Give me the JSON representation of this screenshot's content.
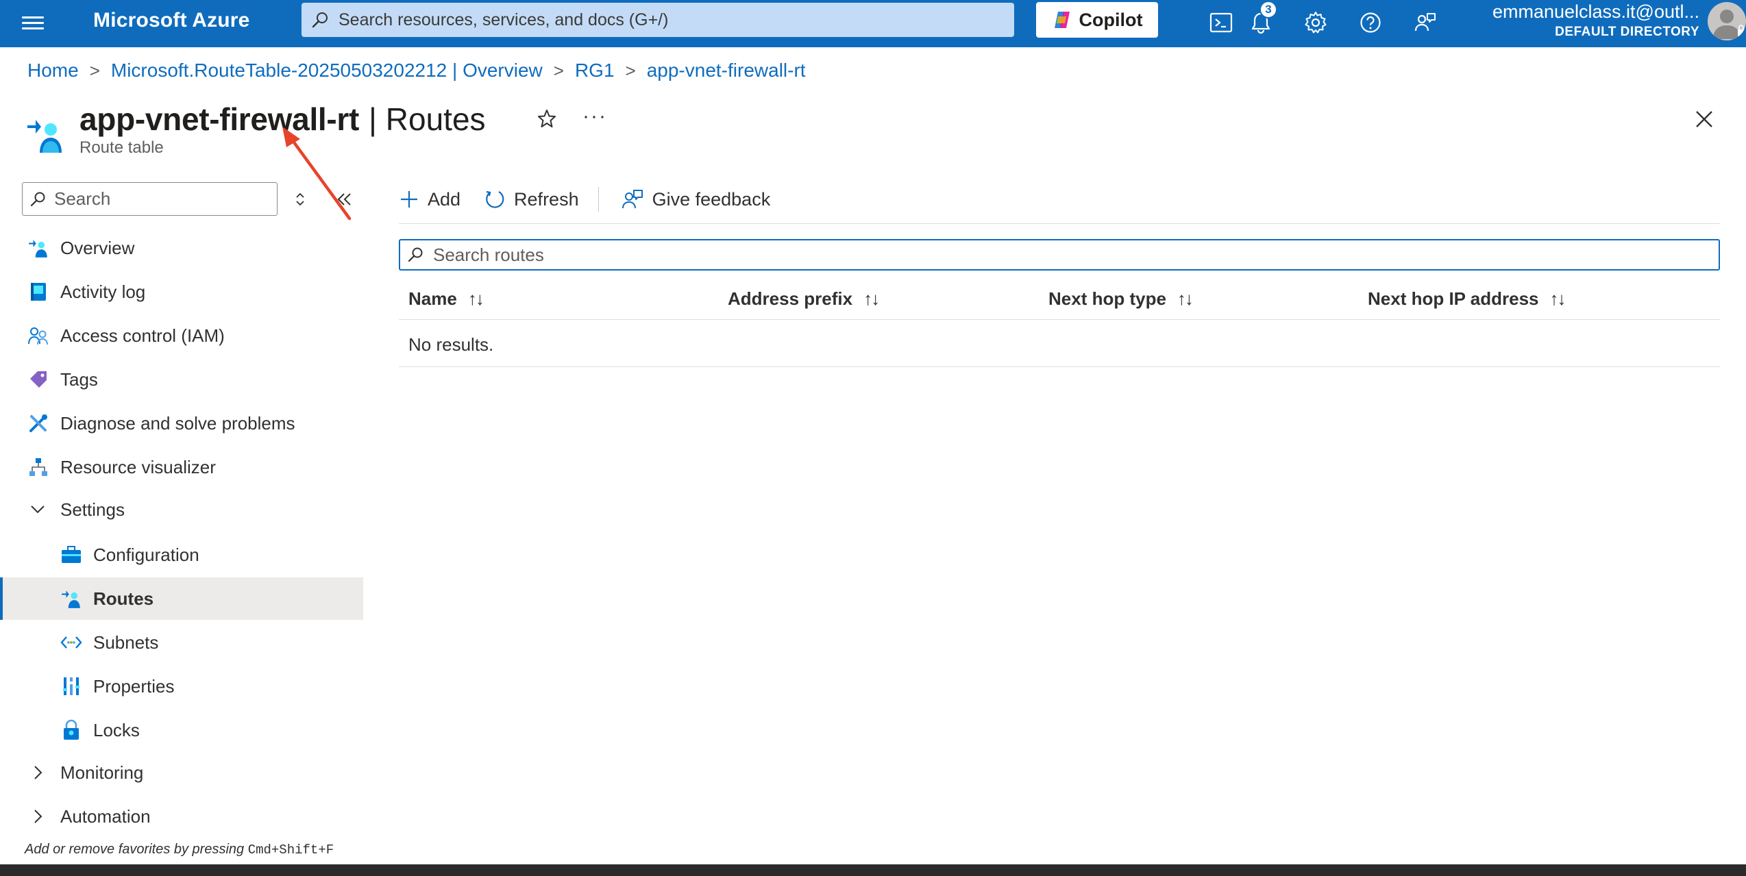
{
  "topbar": {
    "brand": "Microsoft Azure",
    "search_placeholder": "Search resources, services, and docs (G+/)",
    "copilot_label": "Copilot",
    "notification_count": "3",
    "account_email": "emmanuelclass.it@outl...",
    "account_directory": "DEFAULT DIRECTORY",
    "icons": [
      "hamburger-icon",
      "search-icon",
      "copilot-icon",
      "cloud-shell-icon",
      "bell-icon",
      "gear-icon",
      "help-icon",
      "feedback-icon",
      "avatar"
    ]
  },
  "breadcrumb": {
    "items": [
      "Home",
      "Microsoft.RouteTable-20250503202212 | Overview",
      "RG1",
      "app-vnet-firewall-rt"
    ]
  },
  "header": {
    "resource_name": "app-vnet-firewall-rt",
    "page_suffix": "| Routes",
    "resource_type": "Route table"
  },
  "sidebar": {
    "search_placeholder": "Search",
    "items": [
      {
        "label": "Overview",
        "icon": "route-table-icon"
      },
      {
        "label": "Activity log",
        "icon": "activity-log-icon"
      },
      {
        "label": "Access control (IAM)",
        "icon": "iam-icon"
      },
      {
        "label": "Tags",
        "icon": "tag-icon"
      },
      {
        "label": "Diagnose and solve problems",
        "icon": "wrench-icon"
      },
      {
        "label": "Resource visualizer",
        "icon": "visualizer-icon"
      },
      {
        "label": "Settings",
        "icon": "chevron-down-icon"
      },
      {
        "label": "Configuration",
        "icon": "configuration-icon"
      },
      {
        "label": "Routes",
        "icon": "route-table-icon"
      },
      {
        "label": "Subnets",
        "icon": "subnet-icon"
      },
      {
        "label": "Properties",
        "icon": "properties-icon"
      },
      {
        "label": "Locks",
        "icon": "lock-icon"
      },
      {
        "label": "Monitoring",
        "icon": "chevron-right-icon"
      },
      {
        "label": "Automation",
        "icon": "chevron-right-icon"
      }
    ],
    "footer_prefix": "Add or remove favorites by pressing ",
    "footer_shortcut": "Cmd+Shift+F"
  },
  "toolbar": {
    "add_label": "Add",
    "refresh_label": "Refresh",
    "feedback_label": "Give feedback"
  },
  "routes": {
    "search_placeholder": "Search routes",
    "columns": [
      "Name",
      "Address prefix",
      "Next hop type",
      "Next hop IP address"
    ],
    "sort_glyph": "↑↓",
    "empty_text": "No results."
  },
  "colors": {
    "azure_blue": "#0f6cbd",
    "annotation_arrow": "#e8432b"
  }
}
